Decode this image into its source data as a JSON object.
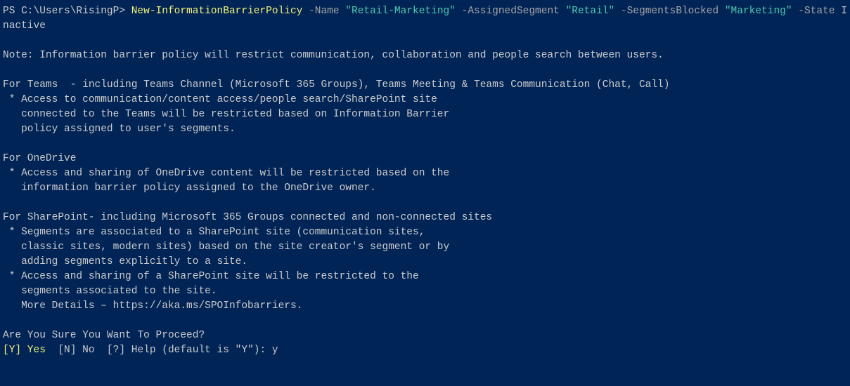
{
  "prompt": {
    "path": "PS C:\\Users\\RisingP>"
  },
  "command": {
    "cmdlet": "New-InformationBarrierPolicy",
    "param1": "-Name",
    "value1": "\"Retail-Marketing\"",
    "param2": "-AssignedSegment",
    "value2": "\"Retail\"",
    "param3": "-SegmentsBlocked",
    "value3": "\"Marketing\"",
    "param4": "-State",
    "value4": "Inactive"
  },
  "output": {
    "note": "Note: Information barrier policy will restrict communication, collaboration and people search between users.",
    "teams": {
      "heading": "For Teams  - including Teams Channel (Microsoft 365 Groups), Teams Meeting & Teams Communication (Chat, Call)",
      "b1": " * Access to communication/content access/people search/SharePoint site",
      "l2": "   connected to the Teams will be restricted based on Information Barrier",
      "l3": "   policy assigned to user's segments."
    },
    "onedrive": {
      "heading": "For OneDrive",
      "b1": " * Access and sharing of OneDrive content will be restricted based on the",
      "l2": "   information barrier policy assigned to the OneDrive owner."
    },
    "sharepoint": {
      "heading": "For SharePoint- including Microsoft 365 Groups connected and non-connected sites",
      "b1": " * Segments are associated to a SharePoint site (communication sites,",
      "l2": "   classic sites, modern sites) based on the site creator's segment or by",
      "l3": "   adding segments explicitly to a site.",
      "b2": " * Access and sharing of a SharePoint site will be restricted to the",
      "l5": "   segments associated to the site.",
      "l6": "   More Details – https://aka.ms/SPOInfobarriers."
    }
  },
  "confirm": {
    "question": "Are You Sure You Want To Proceed?",
    "yes": "[Y] Yes",
    "rest": "  [N] No  [?] Help (default is \"Y\"): ",
    "answer": "y"
  }
}
